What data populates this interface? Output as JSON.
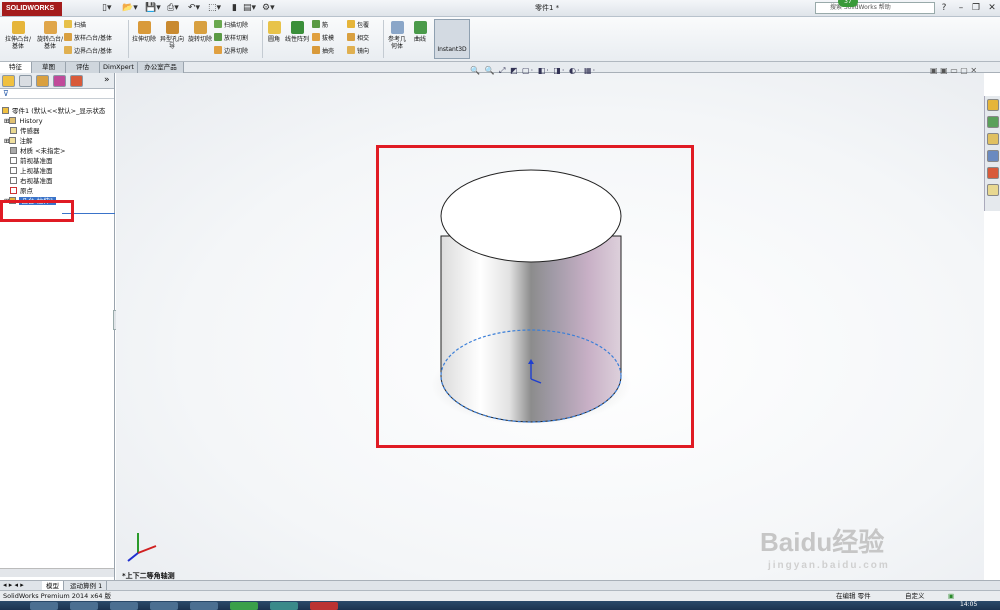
{
  "app": {
    "brand": "SOLIDWORKS",
    "document_title": "零件1 *"
  },
  "help_search": {
    "placeholder": "搜索 SolidWorks 帮助",
    "badge": "37"
  },
  "ribbon": {
    "extrude_boss": "拉伸凸台/基体",
    "revolve_boss": "旋转凸台/基体",
    "sweep": "扫描",
    "loft_boss": "放样凸台/基体",
    "boundary_boss": "边界凸台/基体",
    "extrude_cut": "拉伸切除",
    "hole_wizard": "异型孔向导",
    "revolve_cut": "旋转切除",
    "swept_cut": "扫描切除",
    "lofted_cut": "放样切割",
    "boundary_cut": "边界切除",
    "fillet": "圆角",
    "linear_pattern": "线性阵列",
    "rib": "筋",
    "draft": "拔模",
    "shell": "抽壳",
    "wrap": "包覆",
    "intersect": "相交",
    "mirror": "镜向",
    "ref_geometry": "参考几何体",
    "curves": "曲线",
    "instant3d": "Instant3D"
  },
  "command_tabs": [
    "特征",
    "草图",
    "评估",
    "DimXpert",
    "办公室产品"
  ],
  "feature_tree": {
    "root": "零件1  (默认<<默认>_显示状态",
    "items": [
      "History",
      "传感器",
      "注解",
      "材质 <未指定>",
      "前视基准面",
      "上视基准面",
      "右视基准面",
      "原点"
    ],
    "selected": "凸台-拉伸1"
  },
  "viewport": {
    "view_label": "*上下二等角轴测"
  },
  "bottom_tabs": [
    "模型",
    "运动算例 1"
  ],
  "status": {
    "left": "SolidWorks Premium 2014 x64 版",
    "editing": "在编辑 零件",
    "custom": "自定义"
  },
  "taskbar": {
    "time": "14:05"
  },
  "watermark": {
    "logo": "Baidu经验",
    "url": "jingyan.baidu.com"
  },
  "colors": {
    "accent_red": "#e01b24",
    "selection_blue": "#3a73c9"
  }
}
